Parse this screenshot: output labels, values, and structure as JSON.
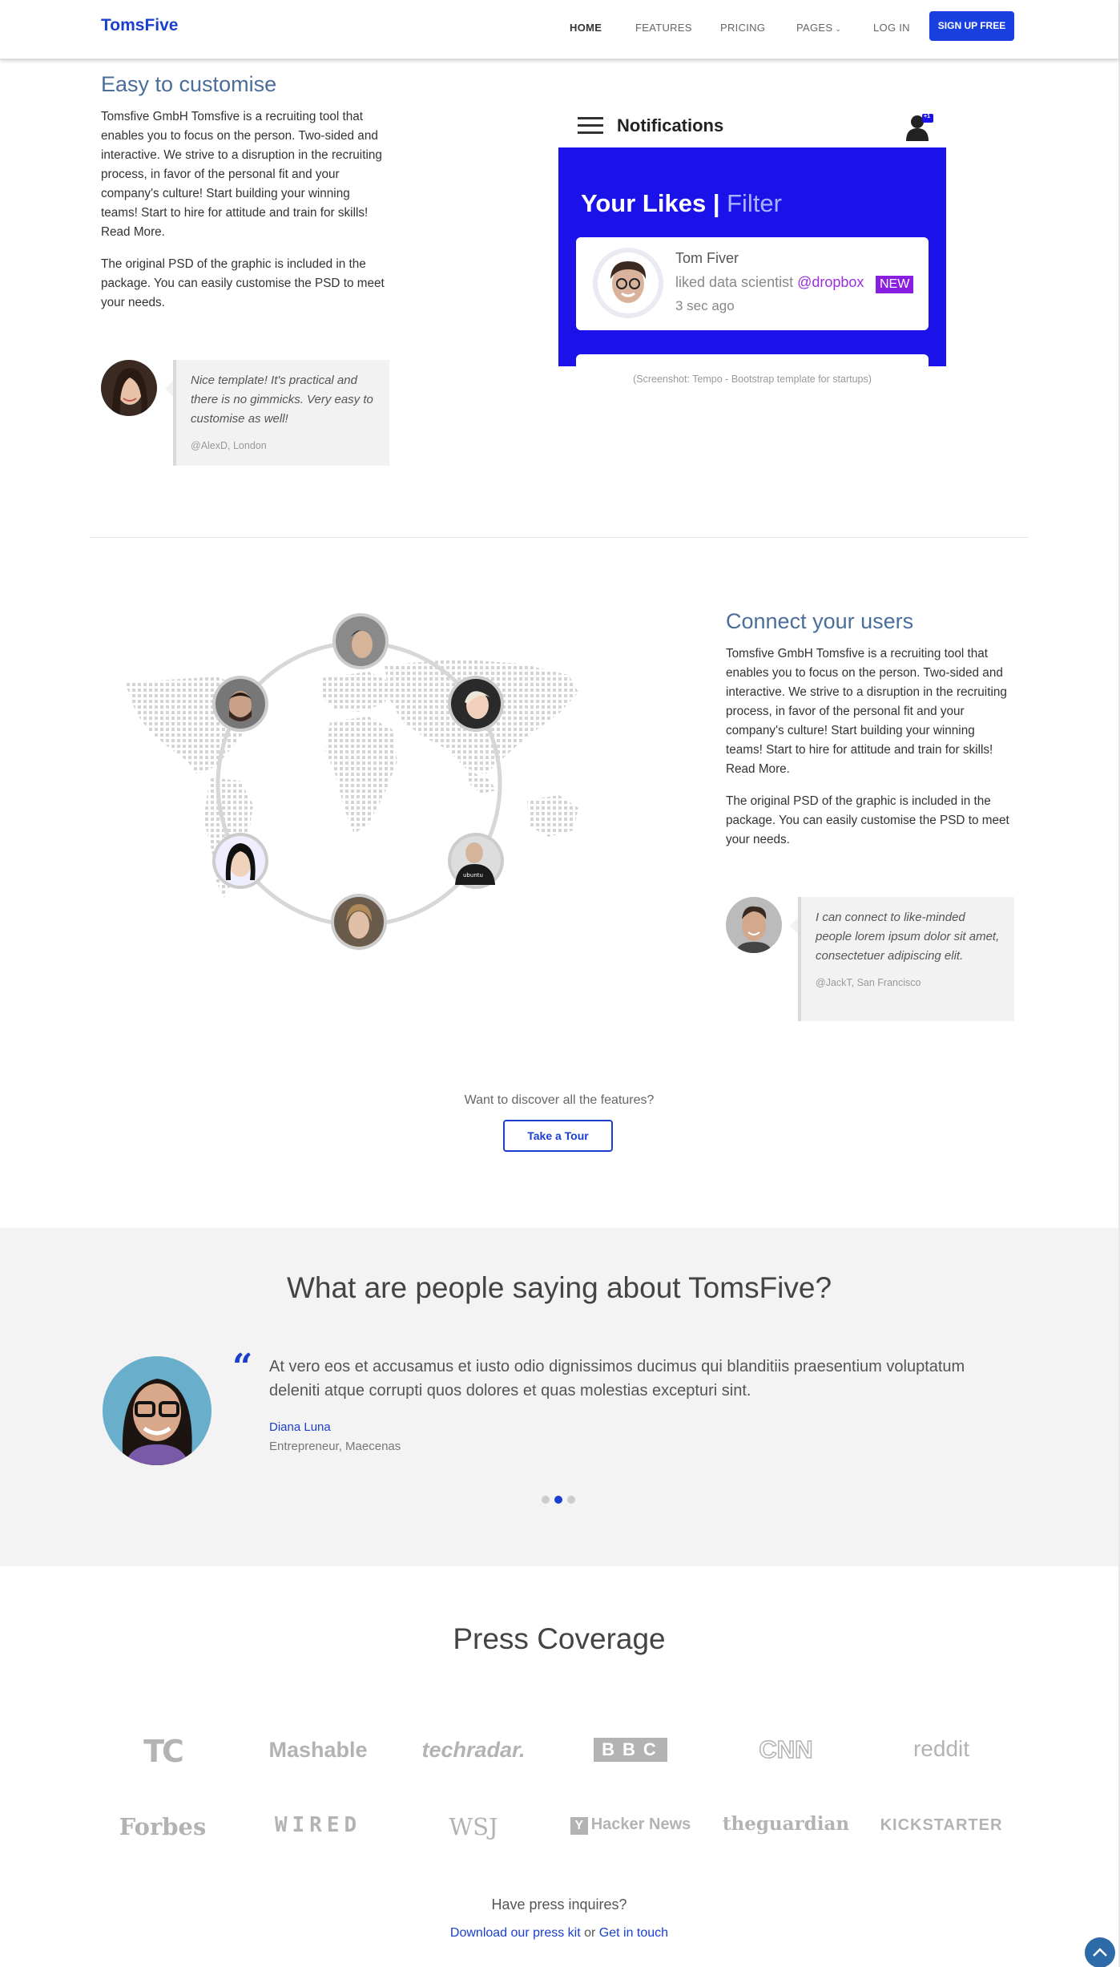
{
  "header": {
    "brand": "TomsFive",
    "nav": [
      "HOME",
      "FEATURES",
      "PRICING",
      "PAGES",
      "LOG IN"
    ],
    "signup": "SIGN UP FREE"
  },
  "section1": {
    "title": "Easy to customise",
    "p1": "Tomsfive GmbH Tomsfive is a recruiting tool that enables you to focus on the person. Two-sided and interactive. We strive to a disruption in the recruiting process, in favor of the personal fit and your company's culture! Start building your winning teams! Start to hire for attitude and train for skills! Read More.",
    "p2": "The original PSD of the graphic is included in the package. You can easily customise the PSD to meet your needs.",
    "quote": "Nice template! It's practical and there is no gimmicks. Very easy to customise as well!",
    "quote_author": "@AlexD, London",
    "mock": {
      "top_title": "Notifications",
      "badge": "+1",
      "heading": "Your Likes",
      "heading_sep": " | ",
      "heading_filter": "Filter",
      "name": "Tom Fiver",
      "action": "liked data scientist",
      "mention": "@dropbox",
      "tag": "NEW",
      "time": "3 sec ago"
    },
    "caption": "(Screenshot: Tempo - Bootstrap template for startups)"
  },
  "section2": {
    "title": "Connect your users",
    "p1": "Tomsfive GmbH Tomsfive is a recruiting tool that enables you to focus on the person. Two-sided and interactive. We strive to a disruption in the recruiting process, in favor of the personal fit and your company's culture! Start building your winning teams! Start to hire for attitude and train for skills! Read More.",
    "p2": "The original PSD of the graphic is included in the package. You can easily customise the PSD to meet your needs.",
    "quote": "I can connect to like-minded people lorem ipsum dolor sit amet, consectetuer adipiscing elit.",
    "quote_author": "@JackT, San Francisco",
    "tshirt_text": "ubuntu"
  },
  "discover": {
    "text": "Want to discover all the features?",
    "button": "Take a Tour"
  },
  "testimonials": {
    "title": "What are people saying about TomsFive?",
    "text": "At vero eos et accusamus et iusto odio dignissimos ducimus qui blanditiis praesentium voluptatum deleniti atque corrupti quos dolores et quas molestias excepturi sint.",
    "name": "Diana Luna",
    "role": "Entrepreneur, Maecenas",
    "active_slide": 2,
    "slide_count": 3
  },
  "press": {
    "title": "Press Coverage",
    "logos_row1": [
      "TC",
      "Mashable",
      "techradar.",
      "BBC",
      "CNN",
      "reddit"
    ],
    "logos_row2": [
      "Forbes",
      "WIRED",
      "WSJ",
      "Hacker News",
      "theguardian",
      "KICKSTARTER"
    ],
    "hn_mark": "Y",
    "inquiry": "Have press inquires?",
    "link1": "Download our press kit",
    "connector": " or ",
    "link2": "Get in touch"
  },
  "colors": {
    "brand_blue": "#1a3fcf",
    "button_blue": "#1a3fe0",
    "heading_blue": "#4a6d9a",
    "mock_blue": "#1a12e8"
  }
}
